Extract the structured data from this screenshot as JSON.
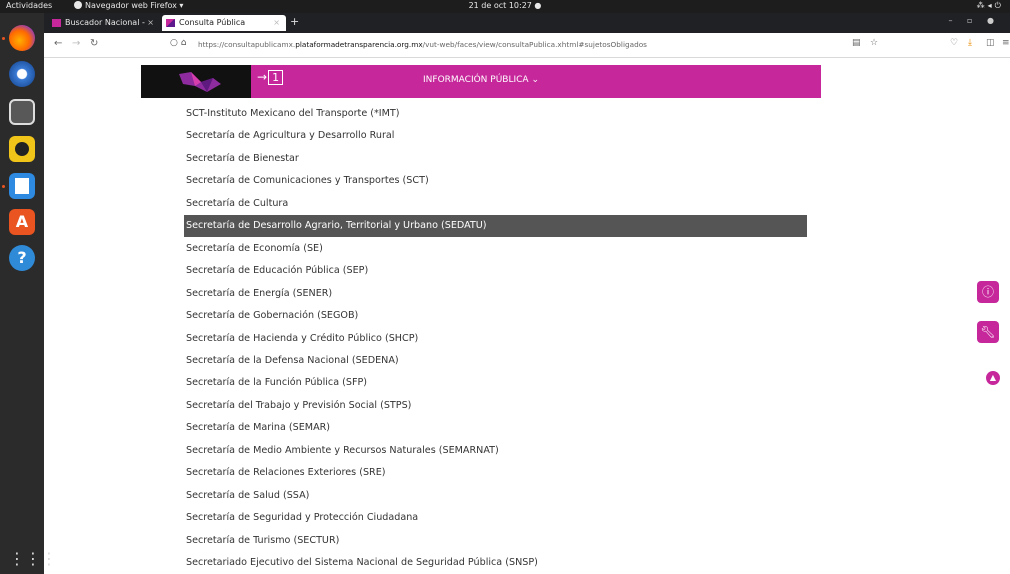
{
  "system_bar": {
    "activities": "Actividades",
    "app_name": "Navegador web Firefox ▾",
    "clock": "21 de oct  10:27  ●"
  },
  "browser": {
    "tabs": [
      {
        "label": "Buscador Nacional - PNT",
        "close": "×"
      },
      {
        "label": "Consulta Pública",
        "close": "×"
      }
    ],
    "new_tab": "+",
    "url_host_prefix": "https://consultapublicamx.",
    "url_host": "plataformadetransparencia.org.mx",
    "url_path": "/vut-web/faces/view/consultaPublica.xhtml#sujetosObligados"
  },
  "banner": {
    "brand_color": "#c6279b",
    "info_label": "INFORMACIÓN PÚBLICA ⌄"
  },
  "list": {
    "selected_index": 5,
    "items": [
      "SCT-Instituto Mexicano del Transporte (*IMT)",
      "Secretaría de Agricultura y Desarrollo Rural",
      "Secretaría de Bienestar",
      "Secretaría de Comunicaciones y Transportes (SCT)",
      "Secretaría de Cultura",
      "Secretaría de Desarrollo Agrario, Territorial y Urbano (SEDATU)",
      "Secretaría de Economía (SE)",
      "Secretaría de Educación Pública (SEP)",
      "Secretaría de Energía (SENER)",
      "Secretaría de Gobernación (SEGOB)",
      "Secretaría de Hacienda y Crédito Público (SHCP)",
      "Secretaría de la Defensa Nacional (SEDENA)",
      "Secretaría de la Función Pública (SFP)",
      "Secretaría del Trabajo y Previsión Social (STPS)",
      "Secretaría de Marina (SEMAR)",
      "Secretaría de Medio Ambiente y Recursos Naturales (SEMARNAT)",
      "Secretaría de Relaciones Exteriores (SRE)",
      "Secretaría de Salud (SSA)",
      "Secretaría de Seguridad y Protección Ciudadana",
      "Secretaría de Turismo (SECTUR)",
      "Secretariado Ejecutivo del Sistema Nacional de Seguridad Pública (SNSP)"
    ]
  }
}
